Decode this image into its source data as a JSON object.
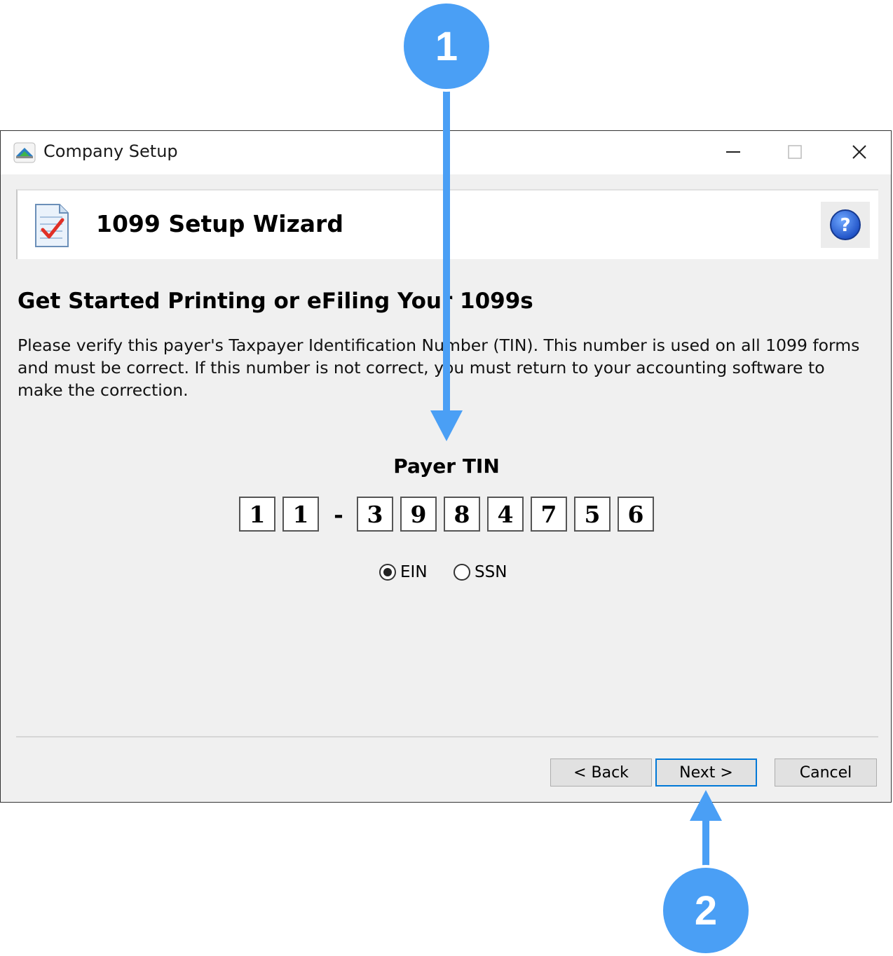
{
  "window": {
    "title": "Company Setup",
    "controls": {
      "minimize_icon": "minimize-icon",
      "maximize_icon": "maximize-icon",
      "close_icon": "close-icon"
    }
  },
  "header": {
    "title": "1099 Setup Wizard",
    "icon": "checklist-document-icon",
    "help_icon": "help-icon"
  },
  "main": {
    "heading": "Get Started Printing or eFiling Your 1099s",
    "description": "Please verify this payer's Taxpayer Identification Number (TIN). This number is used on all 1099 forms and must be correct. If this number is not correct, you must return to your accounting software to make the correction.",
    "tin_label": "Payer TIN",
    "tin_digits": [
      "1",
      "1",
      "3",
      "9",
      "8",
      "4",
      "7",
      "5",
      "6"
    ],
    "tin_separator": "-",
    "tin_type_options": [
      {
        "label": "EIN",
        "selected": true
      },
      {
        "label": "SSN",
        "selected": false
      }
    ]
  },
  "footer": {
    "back_label": "< Back",
    "next_label": "Next >",
    "cancel_label": "Cancel"
  },
  "annotations": {
    "callout_1": "1",
    "callout_2": "2",
    "color": "#4a9ff5"
  }
}
